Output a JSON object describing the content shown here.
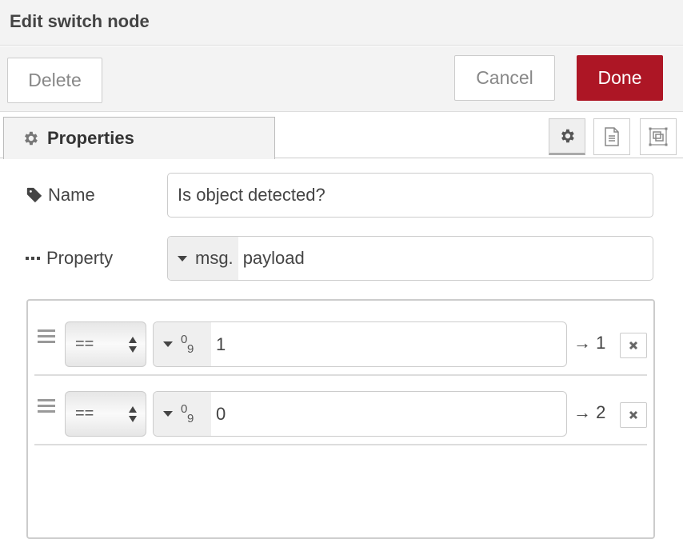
{
  "header": {
    "title": "Edit switch node"
  },
  "actions": {
    "delete_label": "Delete",
    "cancel_label": "Cancel",
    "done_label": "Done",
    "done_color": "#ad1625"
  },
  "tabs": [
    {
      "label": "Properties",
      "icon": "gear-icon",
      "active": true
    }
  ],
  "toolbar": [
    {
      "icon": "gear-icon",
      "active": true
    },
    {
      "icon": "document-icon",
      "active": false
    },
    {
      "icon": "appearance-icon",
      "active": false
    }
  ],
  "form": {
    "name": {
      "label": "Name",
      "icon": "tag-icon",
      "value": "Is object detected?"
    },
    "property": {
      "label": "Property",
      "icon": "ellipsis-icon",
      "type_prefix": "msg.",
      "value": "payload"
    }
  },
  "rules": [
    {
      "operator": "==",
      "value_type": "number",
      "type_icon_top": "0",
      "type_icon_bottom": "9",
      "value": "1",
      "output": "→ 1"
    },
    {
      "operator": "==",
      "value_type": "number",
      "type_icon_top": "0",
      "type_icon_bottom": "9",
      "value": "0",
      "output": "→ 2"
    }
  ]
}
